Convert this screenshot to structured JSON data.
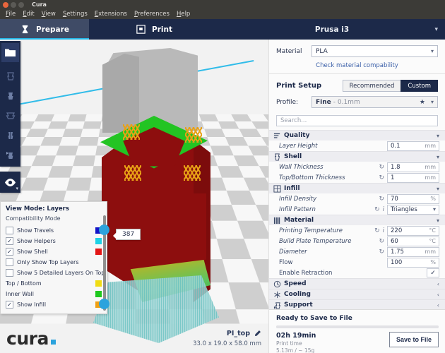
{
  "window": {
    "title": "Cura",
    "controls": [
      "close",
      "minimize",
      "maximize"
    ]
  },
  "menubar": {
    "items": [
      "File",
      "Edit",
      "View",
      "Settings",
      "Extensions",
      "Preferences",
      "Help"
    ]
  },
  "tabs": {
    "prepare": "Prepare",
    "print": "Print",
    "printer": "Prusa i3"
  },
  "toolbar": {
    "tools": [
      "open-file",
      "move",
      "scale",
      "rotate",
      "mirror",
      "per-model-settings"
    ],
    "view_mode_button": "view-eye"
  },
  "viewport": {
    "model_name": "PI_top",
    "model_dimensions": "33.0 x 19.0 x 58.0 mm",
    "logo_text": "cura",
    "layer_value": "387"
  },
  "view_panel": {
    "title": "View Mode: Layers",
    "subtitle": "Compatibility Mode",
    "options": [
      {
        "label": "Show Travels",
        "checked": false,
        "color": "#1414c8",
        "has_checkbox": true
      },
      {
        "label": "Show Helpers",
        "checked": true,
        "color": "#1ed2e6",
        "has_checkbox": true
      },
      {
        "label": "Show Shell",
        "checked": true,
        "color": "#e31616",
        "has_checkbox": true
      },
      {
        "label": "Only Show Top Layers",
        "checked": false,
        "color": null,
        "has_checkbox": true
      },
      {
        "label": "Show 5 Detailed Layers On Top",
        "checked": false,
        "color": null,
        "has_checkbox": true
      },
      {
        "label": "Top / Bottom",
        "checked": null,
        "color": "#f0dc14",
        "has_checkbox": false
      },
      {
        "label": "Inner Wall",
        "checked": null,
        "color": "#1ec81e",
        "has_checkbox": false
      },
      {
        "label": "Show Infill",
        "checked": true,
        "color": "#f0a014",
        "has_checkbox": true
      }
    ]
  },
  "right_panel": {
    "material_label": "Material",
    "material_value": "PLA",
    "compat_link": "Check material compability",
    "print_setup_title": "Print Setup",
    "mode_recommended": "Recommended",
    "mode_custom": "Custom",
    "mode_active": "Custom",
    "profile_label": "Profile:",
    "profile_name": "Fine",
    "profile_detail": "- 0.1mm",
    "search_placeholder": "Search...",
    "categories": [
      {
        "name": "Quality",
        "icon": "quality-icon",
        "expanded": true,
        "settings": [
          {
            "label": "Layer Height",
            "value": "0.1",
            "unit": "mm",
            "reset": false,
            "info": false,
            "type": "text",
            "italic": true
          }
        ]
      },
      {
        "name": "Shell",
        "icon": "shell-icon",
        "expanded": true,
        "settings": [
          {
            "label": "Wall Thickness",
            "value": "1.8",
            "unit": "mm",
            "reset": true,
            "info": false,
            "type": "text",
            "italic": true
          },
          {
            "label": "Top/Bottom Thickness",
            "value": "1",
            "unit": "mm",
            "reset": true,
            "info": false,
            "type": "text",
            "italic": true
          }
        ]
      },
      {
        "name": "Infill",
        "icon": "infill-icon",
        "expanded": true,
        "settings": [
          {
            "label": "Infill Density",
            "value": "70",
            "unit": "%",
            "reset": true,
            "info": false,
            "type": "text",
            "italic": true
          },
          {
            "label": "Infill Pattern",
            "value": "Triangles",
            "unit": "",
            "reset": true,
            "info": true,
            "type": "select",
            "italic": true
          }
        ]
      },
      {
        "name": "Material",
        "icon": "material-icon",
        "expanded": true,
        "settings": [
          {
            "label": "Printing Temperature",
            "value": "220",
            "unit": "°C",
            "reset": true,
            "info": true,
            "type": "text",
            "italic": true
          },
          {
            "label": "Build Plate Temperature",
            "value": "60",
            "unit": "°C",
            "reset": true,
            "info": false,
            "type": "text",
            "italic": true
          },
          {
            "label": "Diameter",
            "value": "1.75",
            "unit": "mm",
            "reset": true,
            "info": false,
            "type": "text",
            "italic": true
          },
          {
            "label": "Flow",
            "value": "100",
            "unit": "%",
            "reset": false,
            "info": false,
            "type": "text",
            "italic": false
          },
          {
            "label": "Enable Retraction",
            "value": "✓",
            "unit": "",
            "reset": false,
            "info": false,
            "type": "checkbox",
            "italic": false
          }
        ]
      },
      {
        "name": "Speed",
        "icon": "speed-icon",
        "expanded": false,
        "settings": []
      },
      {
        "name": "Cooling",
        "icon": "cooling-icon",
        "expanded": false,
        "settings": []
      },
      {
        "name": "Support",
        "icon": "support-icon",
        "expanded": false,
        "settings": []
      }
    ],
    "save": {
      "status": "Ready to Save to File",
      "time": "02h 19min",
      "time_caption": "Print time",
      "material_usage": "5.13m / ~ 15g",
      "button": "Save to File"
    }
  },
  "colors": {
    "header_dark": "#1c2949",
    "tab_active": "#3f4b66",
    "accent_cyan": "#24b7e8",
    "shell_red": "#8d0e0e",
    "inner_wall_green": "#23c423",
    "infill_orange": "#e8a116"
  }
}
